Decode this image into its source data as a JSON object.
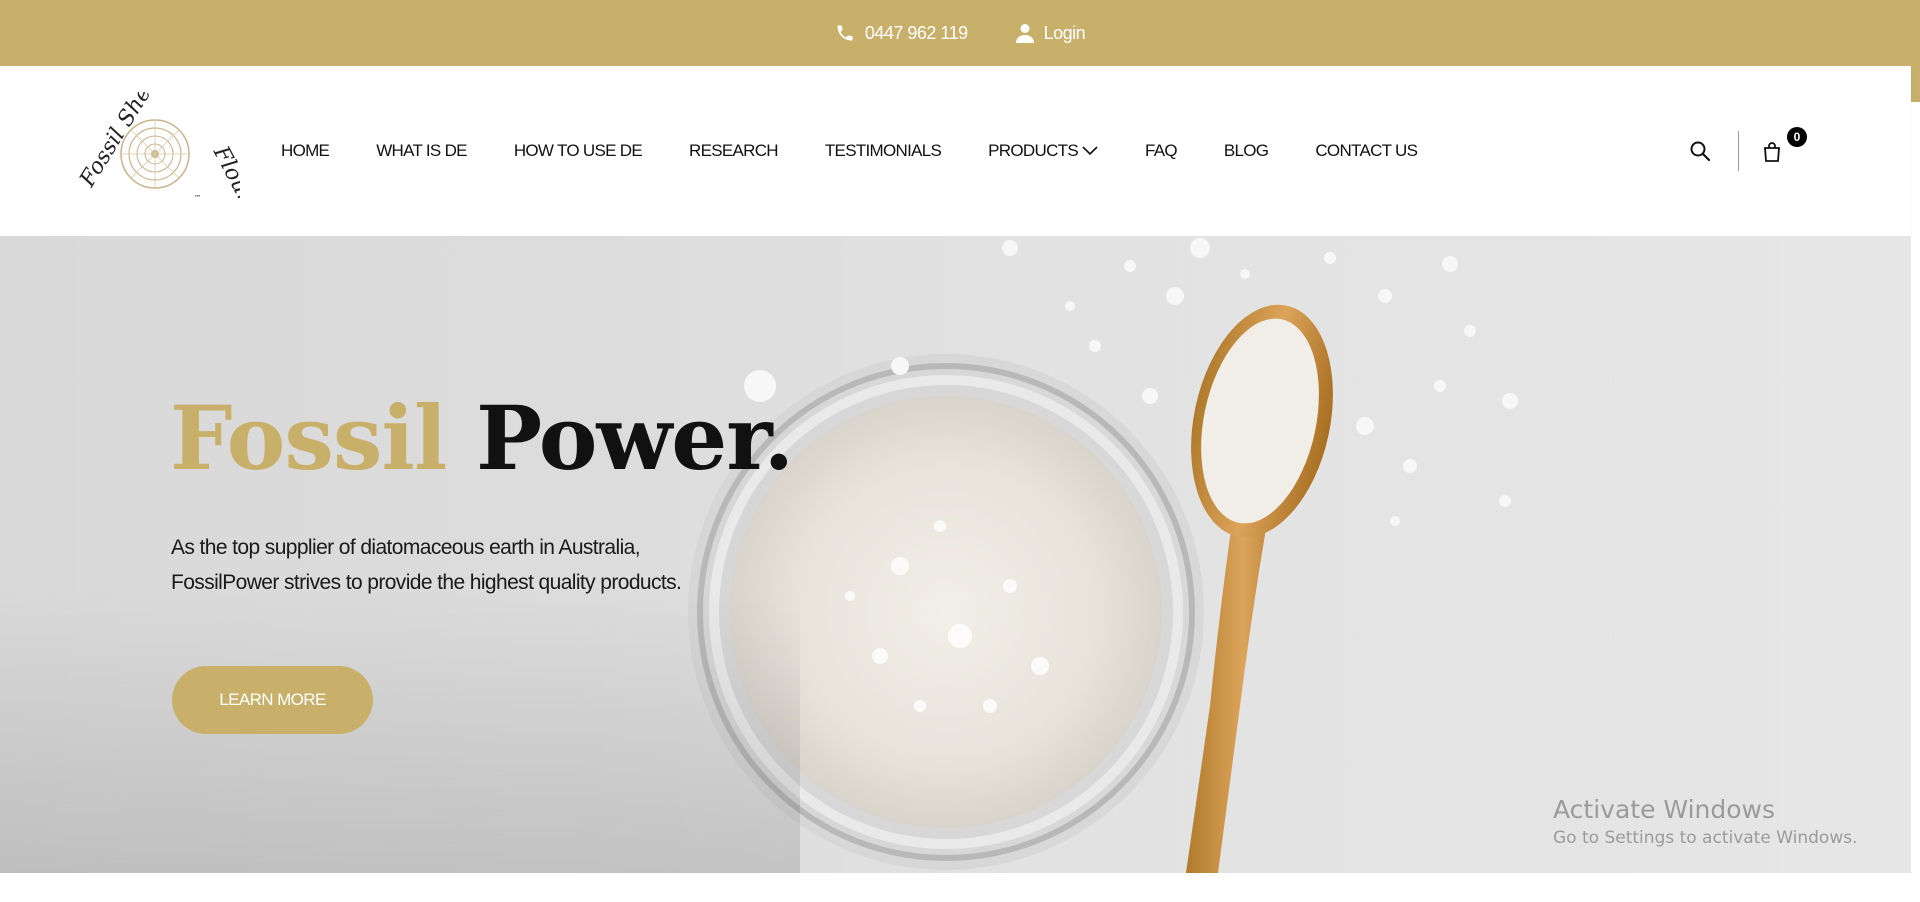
{
  "topbar": {
    "phone": "0447 962 119",
    "login": "Login"
  },
  "brand": {
    "logo_alt": "Fossil Shell Flour",
    "logo_line1": "Fossil Shell",
    "logo_line2": "Flour"
  },
  "nav": {
    "home": "HOME",
    "what_is_de": "WHAT IS DE",
    "how_to_use_de": "HOW TO USE DE",
    "research": "RESEARCH",
    "testimonials": "TESTIMONIALS",
    "products": "PRODUCTS",
    "faq": "FAQ",
    "blog": "BLOG",
    "contact_us": "CONTACT US"
  },
  "cart": {
    "count": "0"
  },
  "hero": {
    "title_gold": "Fossil",
    "title_dark": "Power.",
    "description": "As the top supplier of diatomaceous earth in Australia, FossilPower strives to provide the highest quality products.",
    "cta": "LEARN MORE"
  },
  "watermark": {
    "title": "Activate Windows",
    "subtitle": "Go to Settings to activate Windows."
  },
  "colors": {
    "brand_gold": "#c8b06a",
    "text_dark": "#111111",
    "white": "#ffffff"
  },
  "icons": {
    "phone": "phone-icon",
    "user": "user-icon",
    "search": "search-icon",
    "cart": "bag-icon",
    "chevron": "chevron-down-icon"
  }
}
